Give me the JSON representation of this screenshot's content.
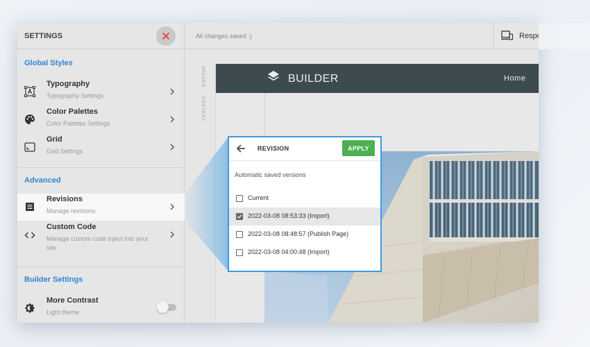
{
  "sidebar": {
    "title": "SETTINGS",
    "close_icon": "close-icon",
    "global_styles_title": "Global Styles",
    "global_items": [
      {
        "label": "Typography",
        "sub": "Typography Settings",
        "icon": "typography-icon"
      },
      {
        "label": "Color Palettes",
        "sub": "Color Palettes Settings",
        "icon": "palette-icon"
      },
      {
        "label": "Grid",
        "sub": "Grid Settings",
        "icon": "grid-icon"
      }
    ],
    "advanced_title": "Advanced",
    "advanced_items": [
      {
        "label": "Revisions",
        "sub": "Manage revisions",
        "icon": "revisions-icon"
      },
      {
        "label": "Custom Code",
        "sub": "Manage custom code inject into your site",
        "icon": "code-icon"
      }
    ],
    "builder_settings_title": "Builder Settings",
    "builder_items": [
      {
        "label": "More Contrast",
        "sub": "Light theme",
        "icon": "contrast-icon",
        "toggle_on": false
      }
    ]
  },
  "topbar": {
    "status": "All changes saved :)",
    "responsive_label": "Responsive",
    "responsive_icon": "devices-icon"
  },
  "ruler": {
    "labels": [
      "HEADER",
      "CONTENT"
    ]
  },
  "canvas": {
    "brand": "BUILDER",
    "brand_icon": "layers-icon",
    "nav": [
      "Home"
    ],
    "nav_color": "#3d4a50"
  },
  "revision_popup": {
    "title": "REVISION",
    "apply_label": "APPLY",
    "subtitle": "Automatic saved versions",
    "items": [
      {
        "label": "Current",
        "checked": false
      },
      {
        "label": "2022-03-08 08:53:33 (Import)",
        "checked": true
      },
      {
        "label": "2022-03-08 08:48:57 (Publish Page)",
        "checked": false
      },
      {
        "label": "2022-03-08 04:00:48 (Import)",
        "checked": false
      }
    ],
    "accent": "#3b9be3",
    "apply_color": "#4caf50"
  },
  "colors": {
    "section_title": "#2f86d4",
    "close_x": "#e53935"
  }
}
